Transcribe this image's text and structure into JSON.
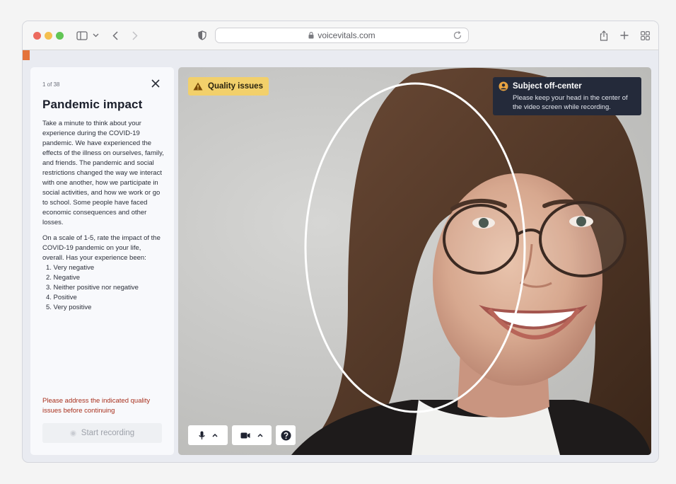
{
  "browser": {
    "url": "voicevitals.com"
  },
  "prompt": {
    "counter": "1 of 38",
    "title": "Pandemic impact",
    "paragraph1": "Take a minute to think about your experience during the COVID-19 pandemic. We have experienced the effects of the illness on ourselves, family, and friends. The pandemic and social restrictions changed the way we interact with one another, how we participate in social activities, and how we work or go to school. Some people have faced economic consequences and other losses.",
    "paragraph2": "On a scale of 1-5, rate the impact of the COVID-19 pandemic on your life, overall. Has your experience been:",
    "options": [
      "1. Very negative",
      "2. Negative",
      "3. Neither positive nor negative",
      "4. Positive",
      "5. Very positive"
    ],
    "warning": "Please address the indicated quality issues before continuing",
    "record_label": "Start recording"
  },
  "video": {
    "quality_badge": "Quality issues",
    "tooltip_title": "Subject off-center",
    "tooltip_desc": "Please keep your head in the center of the video screen while recording."
  },
  "colors": {
    "accent_orange": "#e4733a",
    "badge_yellow": "#f2d06b",
    "warning_red": "#a8301d",
    "tooltip_bg": "#242a3a"
  }
}
